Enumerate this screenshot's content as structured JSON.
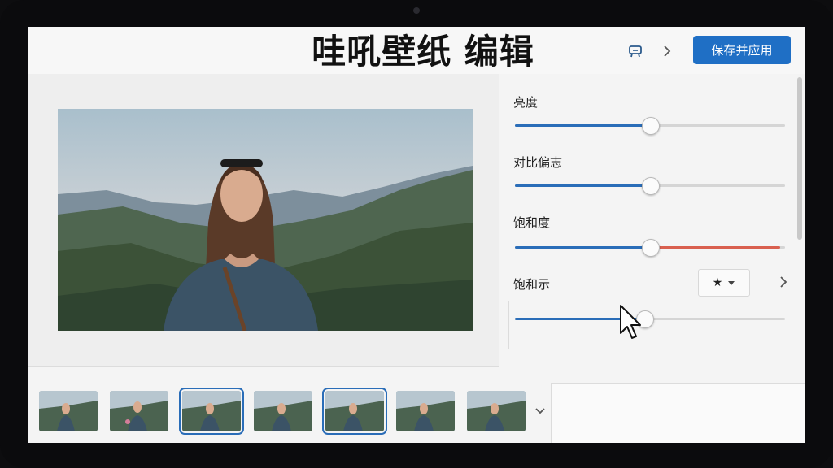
{
  "header": {
    "title": "哇吼壁纸 编辑",
    "save_label": "保存并应用",
    "icons": [
      "device-icon",
      "chevron-right-icon"
    ]
  },
  "controls": [
    {
      "label": "亮度",
      "value": 0.5
    },
    {
      "label": "对比偏志",
      "value": 0.5
    },
    {
      "label": "饱和度",
      "value": 0.5
    },
    {
      "label": "饱和示",
      "value": 0.48
    }
  ],
  "dropdown": {
    "value": "★"
  },
  "thumbnails": {
    "count": 7,
    "selected": [
      2,
      4
    ]
  },
  "colors": {
    "accent": "#1f6fc5",
    "warm_track": "#d9604f"
  }
}
